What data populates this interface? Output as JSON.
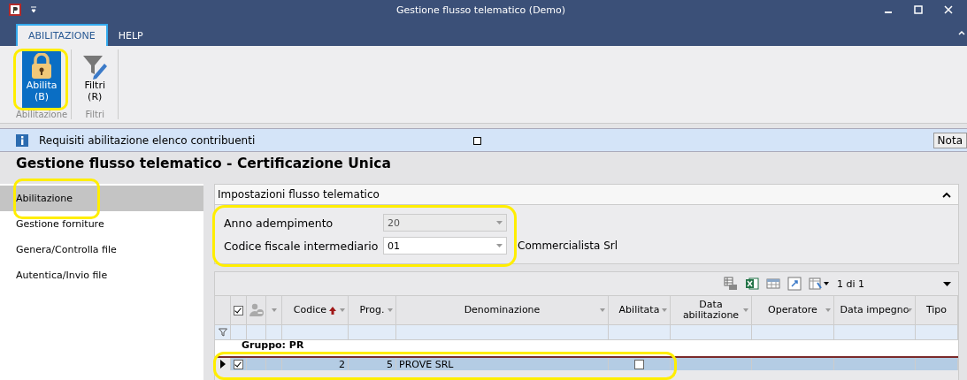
{
  "window": {
    "title": "Gestione flusso telematico  (Demo)"
  },
  "ribbon_tabs": [
    {
      "label": "ABILITAZIONE",
      "selected": true
    },
    {
      "label": "HELP",
      "selected": false
    }
  ],
  "ribbon_groups": [
    {
      "label": "Abilitazione",
      "buttons": [
        {
          "kind": "lock",
          "label": "Abilita",
          "shortcut": "(B)",
          "selected": true
        }
      ]
    },
    {
      "label": "Filtri",
      "buttons": [
        {
          "kind": "filter",
          "label": "Filtri",
          "shortcut": "(R)",
          "selected": false
        }
      ]
    }
  ],
  "info_bar": {
    "text": "Requisiti abilitazione elenco contribuenti",
    "note_button": "Nota"
  },
  "heading": "Gestione flusso telematico - Certificazione Unica",
  "sidebar": {
    "items": [
      {
        "label": "Abilitazione",
        "selected": true
      },
      {
        "label": "Gestione forniture",
        "selected": false
      },
      {
        "label": "Genera/Controlla file",
        "selected": false
      },
      {
        "label": "Autentica/Invio file",
        "selected": false
      }
    ]
  },
  "settings": {
    "title": "Impostazioni flusso telematico",
    "expanded": true,
    "fields": [
      {
        "label": "Anno adempimento",
        "value": "20",
        "disabled": true
      },
      {
        "label": "Codice fiscale intermediario",
        "value": "01",
        "disabled": false,
        "description": "Commercialista Srl"
      }
    ]
  },
  "grid": {
    "pager": "1 di 1",
    "columns": [
      "Codice",
      "Prog.",
      "Denominazione",
      "Abilitata",
      "Data abilitazione",
      "Operatore",
      "Data impegno",
      "Tipo"
    ],
    "all_checked": true,
    "group_label": "Gruppo: PR",
    "rows": [
      {
        "checked": true,
        "selected": true,
        "codice": "2",
        "prog": "5",
        "denominazione": "PROVE SRL",
        "abilitata": false
      }
    ]
  }
}
